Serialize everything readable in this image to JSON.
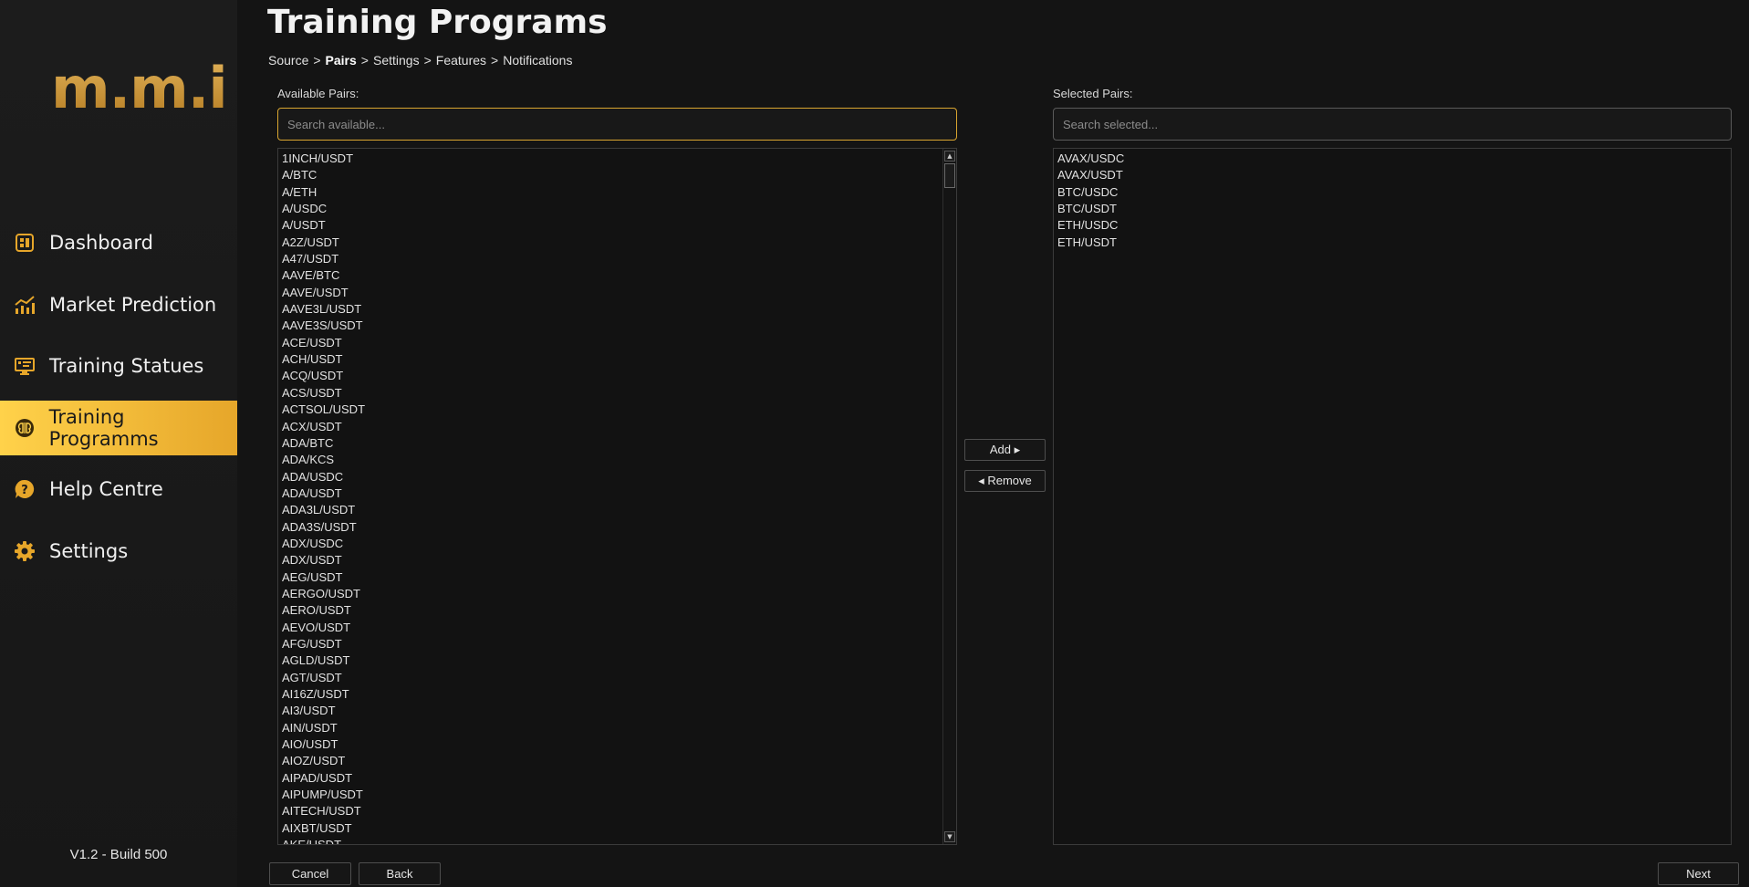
{
  "app": {
    "logo_text": "m.m.i",
    "version": "V1.2 - Build 500"
  },
  "sidebar": {
    "items": [
      {
        "label": "Dashboard",
        "icon": "dashboard-icon",
        "active": false
      },
      {
        "label": "Market Prediction",
        "icon": "chart-icon",
        "active": false
      },
      {
        "label": "Training Statues",
        "icon": "monitor-icon",
        "active": false
      },
      {
        "label": "Training Programms",
        "icon": "brain-icon",
        "active": true
      },
      {
        "label": "Help Centre",
        "icon": "help-icon",
        "active": false
      },
      {
        "label": "Settings",
        "icon": "gear-icon",
        "active": false
      }
    ]
  },
  "header": {
    "title": "Training Programs",
    "breadcrumb": [
      "Source",
      "Pairs",
      "Settings",
      "Features",
      "Notifications"
    ],
    "breadcrumb_current_index": 1,
    "breadcrumb_separator": ">"
  },
  "available": {
    "label": "Available Pairs:",
    "search_placeholder": "Search available...",
    "items": [
      "1INCH/USDT",
      "A/BTC",
      "A/ETH",
      "A/USDC",
      "A/USDT",
      "A2Z/USDT",
      "A47/USDT",
      "AAVE/BTC",
      "AAVE/USDT",
      "AAVE3L/USDT",
      "AAVE3S/USDT",
      "ACE/USDT",
      "ACH/USDT",
      "ACQ/USDT",
      "ACS/USDT",
      "ACTSOL/USDT",
      "ACX/USDT",
      "ADA/BTC",
      "ADA/KCS",
      "ADA/USDC",
      "ADA/USDT",
      "ADA3L/USDT",
      "ADA3S/USDT",
      "ADX/USDC",
      "ADX/USDT",
      "AEG/USDT",
      "AERGO/USDT",
      "AERO/USDT",
      "AEVO/USDT",
      "AFG/USDT",
      "AGLD/USDT",
      "AGT/USDT",
      "AI16Z/USDT",
      "AI3/USDT",
      "AIN/USDT",
      "AIO/USDT",
      "AIOZ/USDT",
      "AIPAD/USDT",
      "AIPUMP/USDT",
      "AITECH/USDT",
      "AIXBT/USDT",
      "AKE/USDT"
    ]
  },
  "selected": {
    "label": "Selected Pairs:",
    "search_placeholder": "Search selected...",
    "items": [
      "AVAX/USDC",
      "AVAX/USDT",
      "BTC/USDC",
      "BTC/USDT",
      "ETH/USDC",
      "ETH/USDT"
    ]
  },
  "actions": {
    "add_label": "Add ▸",
    "remove_label": "◂ Remove",
    "cancel_label": "Cancel",
    "back_label": "Back",
    "next_label": "Next"
  },
  "colors": {
    "accent": "#e6a62a",
    "accent_light": "#ffd24a",
    "background": "#141414",
    "sidebar": "#1b1b1b"
  }
}
